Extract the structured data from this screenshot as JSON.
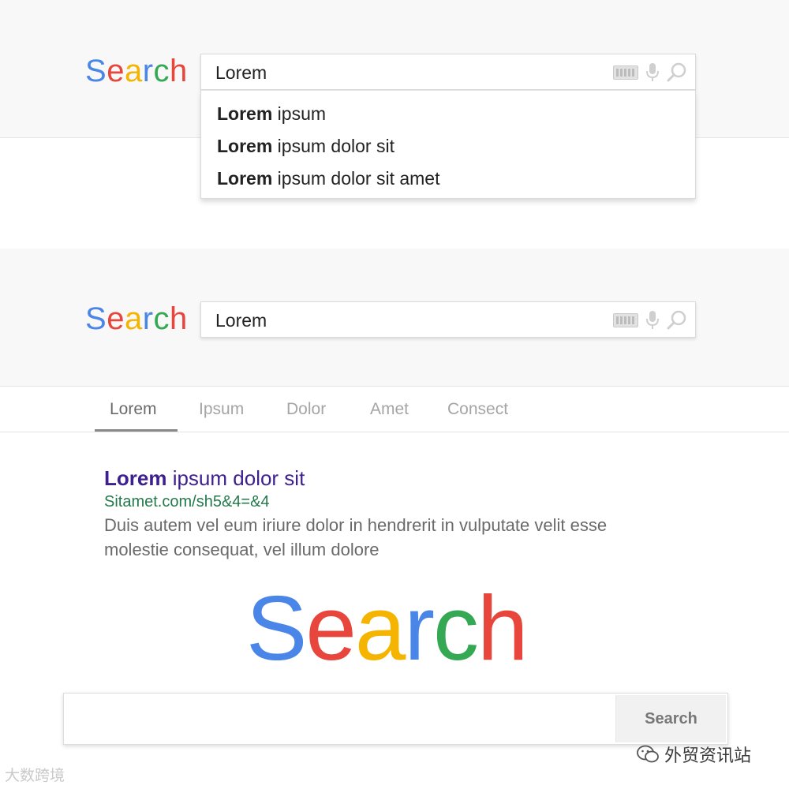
{
  "brand": {
    "letters": [
      "S",
      "e",
      "a",
      "r",
      "c",
      "h"
    ],
    "colors": [
      "#4a86e8",
      "#e8453c",
      "#f4b400",
      "#4a86e8",
      "#34a853",
      "#e8453c"
    ]
  },
  "search_1": {
    "query": "Lorem",
    "suggestions": [
      {
        "bold": "Lorem",
        "rest": " ipsum"
      },
      {
        "bold": "Lorem",
        "rest": " ipsum dolor sit"
      },
      {
        "bold": "Lorem",
        "rest": " ipsum dolor sit amet"
      }
    ]
  },
  "search_2": {
    "query": "Lorem"
  },
  "icons": {
    "keyboard": "keyboard-icon",
    "mic": "microphone-icon",
    "search": "magnifier-icon"
  },
  "tabs": [
    {
      "label": "Lorem",
      "active": true
    },
    {
      "label": "Ipsum",
      "active": false
    },
    {
      "label": "Dolor",
      "active": false
    },
    {
      "label": "Amet",
      "active": false
    },
    {
      "label": "Consect",
      "active": false
    }
  ],
  "result": {
    "title_bold": "Lorem",
    "title_rest": " ipsum dolor sit",
    "url": "Sitamet.com/sh5&4=&4",
    "snippet_line1": "Duis autem vel eum iriure dolor in hendrerit in vulputate velit esse",
    "snippet_line2": "molestie consequat, vel illum dolore",
    "title_color": "#3e1f8f",
    "url_color": "#237a4b"
  },
  "home_search": {
    "input_value": "",
    "button_label": "Search"
  },
  "watermarks": {
    "left": "大数跨境",
    "right": "外贸资讯站"
  }
}
